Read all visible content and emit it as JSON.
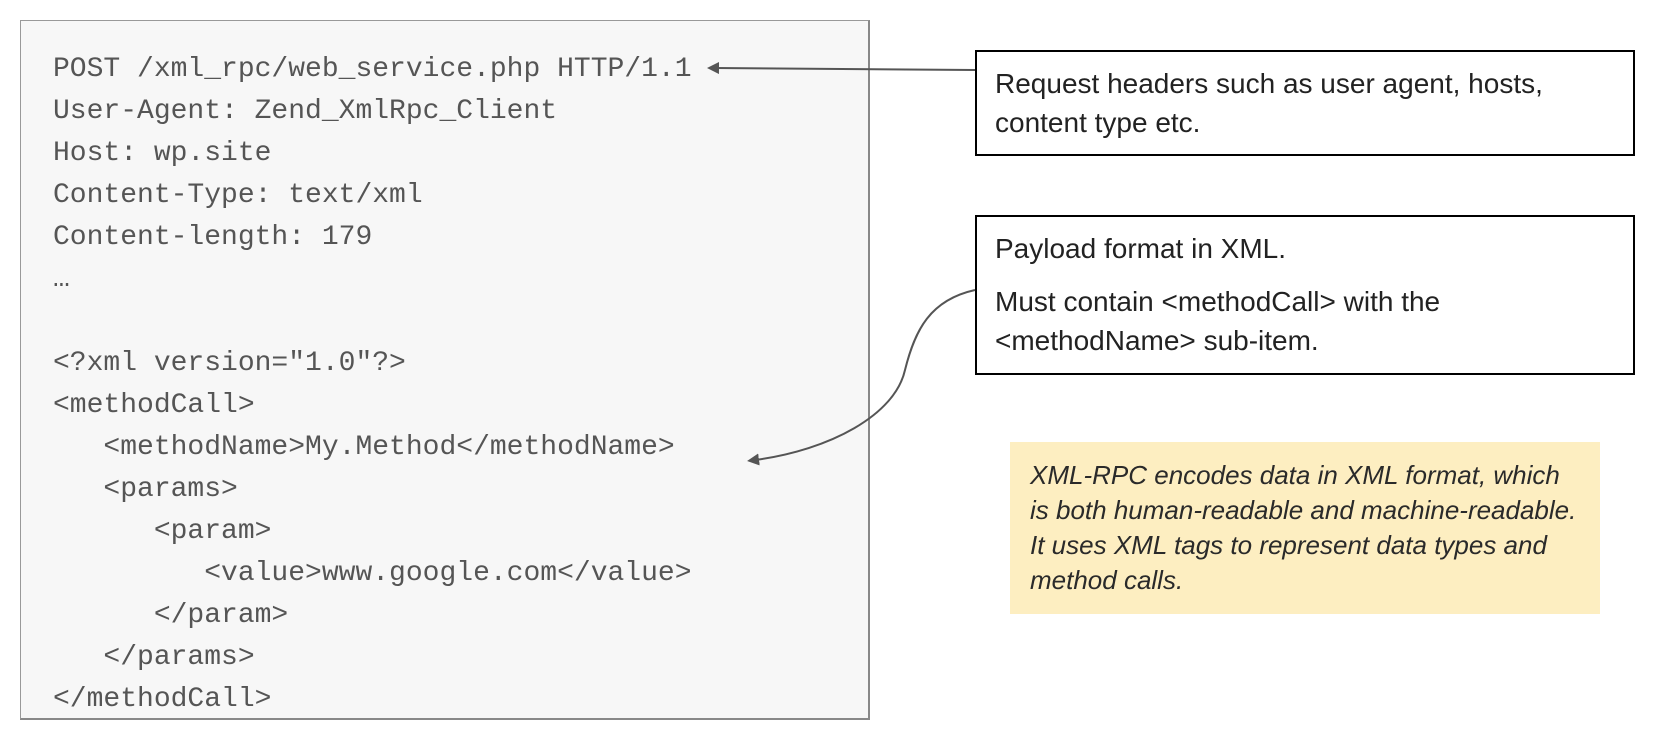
{
  "code": {
    "lines": [
      "POST /xml_rpc/web_service.php HTTP/1.1",
      "User-Agent: Zend_XmlRpc_Client",
      "Host: wp.site",
      "Content-Type: text/xml",
      "Content-length: 179",
      "…",
      "",
      "<?xml version=\"1.0\"?>",
      "<methodCall>",
      "   <methodName>My.Method</methodName>",
      "   <params>",
      "      <param>",
      "         <value>www.google.com</value>",
      "      </param>",
      "   </params>",
      "</methodCall>"
    ]
  },
  "callouts": {
    "headers": "Request headers such as user agent, hosts, content type etc.",
    "payload_line1": "Payload format in XML.",
    "payload_line2": "Must contain <methodCall> with the <methodName> sub-item."
  },
  "note": "XML-RPC encodes data in XML format, which is both human-readable and machine-readable. It uses XML tags to represent data types and method calls."
}
